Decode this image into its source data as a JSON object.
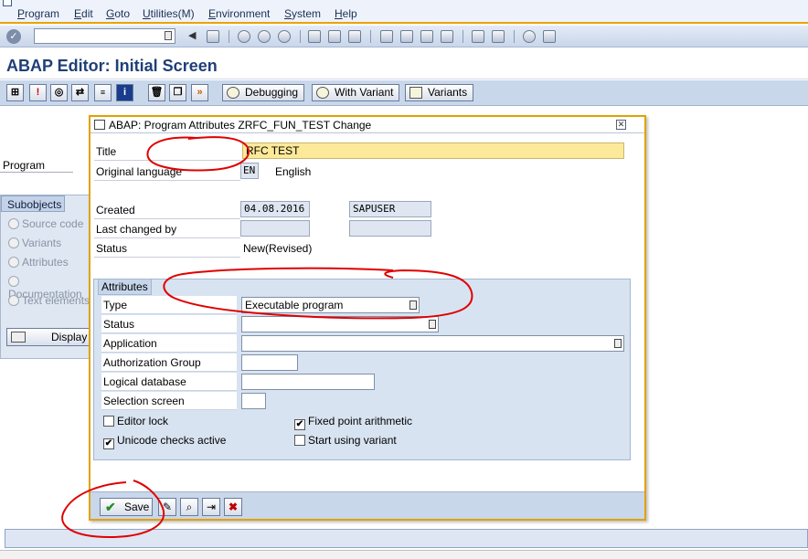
{
  "menu": [
    "Program",
    "Edit",
    "Goto",
    "Utilities(M)",
    "Environment",
    "System",
    "Help"
  ],
  "toolbar": {
    "command_field_value": "",
    "icons": [
      "enter-icon",
      "back-icon",
      "save-icon",
      "back-arrow-icon",
      "exit-icon",
      "cancel-icon",
      "print-icon",
      "find-icon",
      "find-next-icon",
      "first-page-icon",
      "prev-page-icon",
      "next-page-icon",
      "last-page-icon",
      "new-session-icon",
      "shortcut-icon",
      "help-icon",
      "layout-icon"
    ]
  },
  "page_title": "ABAP Editor: Initial Screen",
  "app_toolbar": {
    "icons": [
      "object-list-icon",
      "active-inactive-icon",
      "check-icon",
      "direct-processing-icon",
      "where-used-icon",
      "info-icon",
      "delete-icon",
      "copy-icon",
      "execute-icon"
    ],
    "buttons": [
      "Debugging",
      "With Variant",
      "Variants"
    ]
  },
  "background": {
    "program_label": "Program",
    "subobjects_header": "Subobjects",
    "subobjects": [
      "Source code",
      "Variants",
      "Attributes",
      "Documentation",
      "Text elements"
    ],
    "display_button": "Display"
  },
  "dialog": {
    "title": "ABAP: Program Attributes ZRFC_FUN_TEST Change",
    "title_label": "Title",
    "title_value": "RFC TEST",
    "orig_lang_label": "Original language",
    "orig_lang_code": "EN",
    "orig_lang_name": "English",
    "created_label": "Created",
    "created_date": "04.08.2016",
    "created_user": "SAPUSER",
    "last_changed_label": "Last changed by",
    "last_changed_date": "",
    "last_changed_user": "",
    "status_label": "Status",
    "status_value": "New(Revised)",
    "attributes": {
      "header": "Attributes",
      "type_label": "Type",
      "type_value": "Executable program",
      "status_label": "Status",
      "status_value": "",
      "application_label": "Application",
      "application_value": "",
      "auth_group_label": "Authorization Group",
      "auth_group_value": "",
      "logical_db_label": "Logical database",
      "logical_db_value": "",
      "selection_screen_label": "Selection screen",
      "selection_screen_value": "",
      "editor_lock_label": "Editor lock",
      "editor_lock_checked": false,
      "fixed_point_label": "Fixed point arithmetic",
      "fixed_point_checked": true,
      "unicode_label": "Unicode checks active",
      "unicode_checked": true,
      "start_variant_label": "Start using variant",
      "start_variant_checked": false
    },
    "footer": {
      "save_label": "Save",
      "icons": [
        "check-syntax-icon",
        "find-icon",
        "move-icon",
        "cancel-icon"
      ]
    }
  },
  "colors": {
    "accent_border": "#e0a200",
    "title_blue": "#1f3f78",
    "annotation_red": "#e00000"
  }
}
